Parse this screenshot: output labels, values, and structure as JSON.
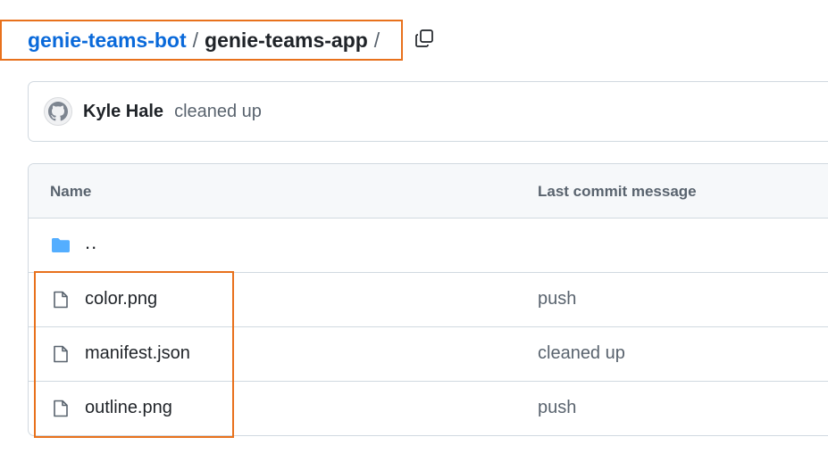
{
  "breadcrumb": {
    "repo": "genie-teams-bot",
    "separator": "/",
    "folder": "genie-teams-app",
    "trailing": "/"
  },
  "copy_button": {
    "icon": "copy-icon"
  },
  "commit": {
    "avatar_icon": "github-octocat-icon",
    "author": "Kyle Hale",
    "message": "cleaned up"
  },
  "table": {
    "headers": {
      "name": "Name",
      "last_commit": "Last commit message"
    },
    "parent": {
      "label": "..",
      "icon": "folder-icon"
    },
    "files": [
      {
        "name": "color.png",
        "message": "push",
        "icon": "file-icon"
      },
      {
        "name": "manifest.json",
        "message": "cleaned up",
        "icon": "file-icon"
      },
      {
        "name": "outline.png",
        "message": "push",
        "icon": "file-icon"
      }
    ]
  },
  "colors": {
    "link": "#0969da",
    "highlight": "#e8711c",
    "folder": "#54aeff",
    "muted": "#59636e"
  }
}
